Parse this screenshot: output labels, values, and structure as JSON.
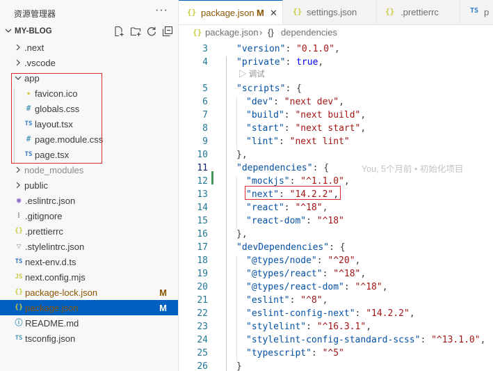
{
  "sidebar": {
    "title": "资源管理器",
    "more": "···",
    "project": "MY-BLOG",
    "items": [
      {
        "name": ".next",
        "icon": "chevron-right",
        "glyph": ""
      },
      {
        "name": ".vscode",
        "icon": "chevron-right",
        "glyph": ""
      },
      {
        "name": "app",
        "icon": "chevron-down",
        "glyph": ""
      },
      {
        "name": "favicon.ico",
        "icon": "star-icon",
        "glyph": "★"
      },
      {
        "name": "globals.css",
        "icon": "hash-icon",
        "glyph": "#"
      },
      {
        "name": "layout.tsx",
        "icon": "ts-icon",
        "glyph": "TS"
      },
      {
        "name": "page.module.css",
        "icon": "hash-icon",
        "glyph": "#"
      },
      {
        "name": "page.tsx",
        "icon": "ts-icon",
        "glyph": "TS"
      },
      {
        "name": "node_modules",
        "icon": "chevron-right",
        "glyph": ""
      },
      {
        "name": "public",
        "icon": "chevron-right",
        "glyph": ""
      },
      {
        "name": ".eslintrc.json",
        "icon": "eslint-icon",
        "glyph": "◉"
      },
      {
        "name": ".gitignore",
        "icon": "gitignore-icon",
        "glyph": "⁝"
      },
      {
        "name": ".prettierrc",
        "icon": "braces-icon",
        "glyph": "{}"
      },
      {
        "name": ".stylelintrc.json",
        "icon": "stylelint-icon",
        "glyph": "▽"
      },
      {
        "name": "next-env.d.ts",
        "icon": "ts-icon",
        "glyph": "TS"
      },
      {
        "name": "next.config.mjs",
        "icon": "js-icon",
        "glyph": "JS"
      },
      {
        "name": "package-lock.json",
        "icon": "braces-icon",
        "glyph": "{}",
        "badge": "M"
      },
      {
        "name": "package.json",
        "icon": "braces-icon",
        "glyph": "{}",
        "badge": "M"
      },
      {
        "name": "README.md",
        "icon": "info-icon",
        "glyph": "ⓘ"
      },
      {
        "name": "tsconfig.json",
        "icon": "tsconfig-icon",
        "glyph": "TS"
      }
    ]
  },
  "tabs": [
    {
      "label": "package.json",
      "glyph": "{}",
      "modified": "M",
      "close": "✕"
    },
    {
      "label": "settings.json",
      "glyph": "{}"
    },
    {
      "label": ".prettierrc",
      "glyph": "{}"
    },
    {
      "label": "p",
      "glyph": "TS"
    }
  ],
  "breadcrumb": {
    "file_glyph": "{}",
    "file": "package.json",
    "sep": "›",
    "node_glyph": "{}",
    "node": "dependencies"
  },
  "editor": {
    "codelens": "▷ 调试",
    "blame": "You, 5个月前 • 初始化项目",
    "lines": [
      {
        "n": "3",
        "key": "version",
        "val": "\"0.1.0\"",
        "ind": 1,
        "tail": ","
      },
      {
        "n": "4",
        "key": "private",
        "val": "true",
        "ind": 1,
        "tail": ",",
        "bool": true
      },
      {
        "n": "5",
        "key": "scripts",
        "open": "{",
        "ind": 1
      },
      {
        "n": "6",
        "key": "dev",
        "val": "\"next dev\"",
        "ind": 2,
        "tail": ","
      },
      {
        "n": "7",
        "key": "build",
        "val": "\"next build\"",
        "ind": 2,
        "tail": ","
      },
      {
        "n": "8",
        "key": "start",
        "val": "\"next start\"",
        "ind": 2,
        "tail": ","
      },
      {
        "n": "9",
        "key": "lint",
        "val": "\"next lint\"",
        "ind": 2
      },
      {
        "n": "10",
        "close": "},",
        "ind": 1
      },
      {
        "n": "11",
        "key": "dependencies",
        "open": "{",
        "ind": 1
      },
      {
        "n": "12",
        "key": "mockjs",
        "val": "\"^1.1.0\"",
        "ind": 2,
        "tail": ","
      },
      {
        "n": "13",
        "key": "next",
        "val": "\"14.2.2\"",
        "ind": 2,
        "tail": ","
      },
      {
        "n": "14",
        "key": "react",
        "val": "\"^18\"",
        "ind": 2,
        "tail": ","
      },
      {
        "n": "15",
        "key": "react-dom",
        "val": "\"^18\"",
        "ind": 2
      },
      {
        "n": "16",
        "close": "},",
        "ind": 1
      },
      {
        "n": "17",
        "key": "devDependencies",
        "open": "{",
        "ind": 1
      },
      {
        "n": "18",
        "key": "@types/node",
        "val": "\"^20\"",
        "ind": 2,
        "tail": ","
      },
      {
        "n": "19",
        "key": "@types/react",
        "val": "\"^18\"",
        "ind": 2,
        "tail": ","
      },
      {
        "n": "20",
        "key": "@types/react-dom",
        "val": "\"^18\"",
        "ind": 2,
        "tail": ","
      },
      {
        "n": "21",
        "key": "eslint",
        "val": "\"^8\"",
        "ind": 2,
        "tail": ","
      },
      {
        "n": "22",
        "key": "eslint-config-next",
        "val": "\"14.2.2\"",
        "ind": 2,
        "tail": ","
      },
      {
        "n": "23",
        "key": "stylelint",
        "val": "\"^16.3.1\"",
        "ind": 2,
        "tail": ","
      },
      {
        "n": "24",
        "key": "stylelint-config-standard-scss",
        "val": "\"^13.1.0\"",
        "ind": 2,
        "tail": ","
      },
      {
        "n": "25",
        "key": "typescript",
        "val": "\"^5\"",
        "ind": 2
      },
      {
        "n": "26",
        "close": "}",
        "ind": 1
      }
    ]
  },
  "colors": {
    "accent": "#0060c0",
    "modified": "#895503",
    "highlight_box": "#d92b2b",
    "json_key": "#0451a5",
    "json_string": "#a31515"
  }
}
